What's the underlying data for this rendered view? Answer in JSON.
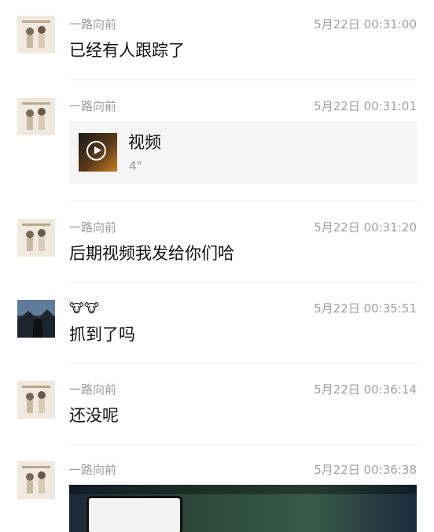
{
  "messages": [
    {
      "sender": "一路向前",
      "time": "5月22日 00:31:00",
      "text": "已经有人跟踪了"
    },
    {
      "sender": "一路向前",
      "time": "5月22日 00:31:01",
      "video": {
        "title": "视频",
        "duration": "4\""
      }
    },
    {
      "sender": "一路向前",
      "time": "5月22日 00:31:20",
      "text": "后期视频我发给你们哈"
    },
    {
      "sender": "🐮🐮",
      "time": "5月22日 00:35:51",
      "text": "抓到了吗"
    },
    {
      "sender": "一路向前",
      "time": "5月22日 00:36:14",
      "text": "还没呢"
    },
    {
      "sender": "一路向前",
      "time": "5月22日 00:36:38",
      "image": "game-screenshot"
    }
  ]
}
